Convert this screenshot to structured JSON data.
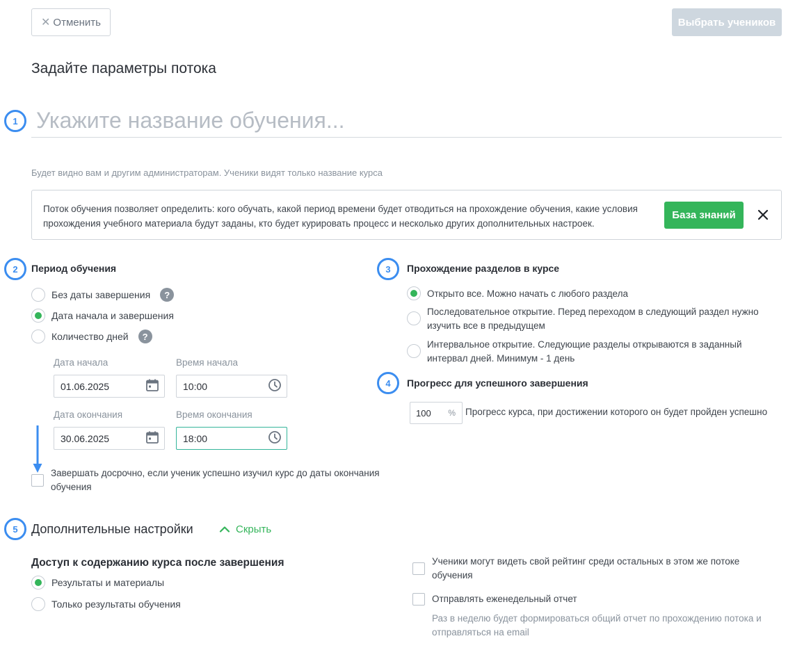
{
  "header": {
    "cancel_label": "Отменить",
    "select_students_label": "Выбрать учеников",
    "page_title": "Задайте параметры потока"
  },
  "name_section": {
    "step": "1",
    "placeholder": "Укажите название обучения...",
    "hint": "Будет видно вам и другим администраторам. Ученики видят только название курса"
  },
  "info_box": {
    "text": "Поток обучения позволяет определить: кого обучать, какой период времени будет отводиться на прохождение обучения, какие условия прохождения учебного материала будут заданы, кто будет курировать процесс и несколько других дополнительных настроек.",
    "knowledge_base_label": "База знаний"
  },
  "period": {
    "step": "2",
    "title": "Период обучения",
    "options": [
      {
        "label": "Без даты завершения",
        "selected": false,
        "help": true
      },
      {
        "label": "Дата начала и завершения",
        "selected": true,
        "help": false
      },
      {
        "label": "Количество дней",
        "selected": false,
        "help": true
      }
    ],
    "help_glyph": "?",
    "start_date_label": "Дата начала",
    "start_date": "01.06.2025",
    "start_time_label": "Время начала",
    "start_time": "10:00",
    "end_date_label": "Дата окончания",
    "end_date": "30.06.2025",
    "end_time_label": "Время окончания",
    "end_time": "18:00",
    "early_finish_label": "Завершать досрочно, если ученик успешно изучил курс до даты окончания обучения",
    "early_finish_checked": false
  },
  "sections": {
    "step": "3",
    "title": "Прохождение разделов в курсе",
    "options": [
      {
        "label": "Открыто все. Можно начать с любого раздела",
        "selected": true
      },
      {
        "label": "Последовательное открытие. Перед переходом в следующий раздел нужно изучить все в предыдущем",
        "selected": false
      },
      {
        "label": "Интервальное открытие. Следующие разделы открываются в заданный интервал дней. Минимум - 1 день",
        "selected": false
      }
    ]
  },
  "progress": {
    "step": "4",
    "title": "Прогресс для успешного завершения",
    "value": "100",
    "unit": "%",
    "description": "Прогресс курса, при достижении которого он будет пройден успешно"
  },
  "extra": {
    "step": "5",
    "title": "Дополнительные настройки",
    "hide_label": "Скрыть",
    "access_title": "Доступ к содержанию курса после завершения",
    "access_options": [
      {
        "label": "Результаты и материалы",
        "selected": true
      },
      {
        "label": "Только результаты обучения",
        "selected": false
      }
    ],
    "rating_label": "Ученики могут видеть свой рейтинг среди остальных в этом же потоке обучения",
    "weekly_report_label": "Отправлять еженедельный отчет",
    "weekly_report_hint": "Раз в неделю будет формироваться общий отчет по прохождению потока и отправляться на email"
  },
  "colors": {
    "accent_blue": "#3b8df0",
    "accent_green": "#34b55a"
  }
}
